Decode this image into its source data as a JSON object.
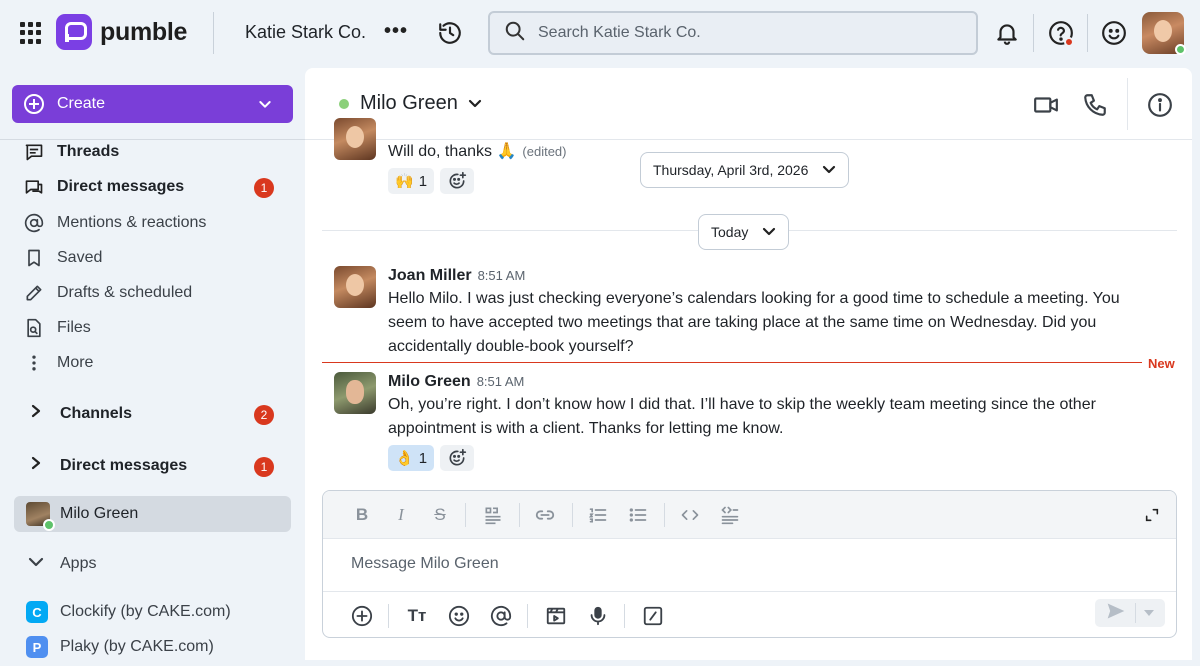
{
  "topbar": {
    "logo_text": "pumble",
    "workspace_name": "Katie Stark Co.",
    "more_label": "•••",
    "search_placeholder": "Search Katie Stark Co."
  },
  "sidebar": {
    "create_label": "Create",
    "nav": [
      {
        "label": "Threads",
        "icon": "threads-icon"
      },
      {
        "label": "Direct messages",
        "icon": "direct-messages-icon",
        "badge": "1"
      },
      {
        "label": "Mentions & reactions",
        "icon": "at-icon"
      },
      {
        "label": "Saved",
        "icon": "bookmark-icon"
      },
      {
        "label": "Drafts & scheduled",
        "icon": "pencil-icon"
      },
      {
        "label": "Files",
        "icon": "file-icon"
      },
      {
        "label": "More",
        "icon": "vertical-dots-icon"
      }
    ],
    "channels": {
      "label": "Channels",
      "badge": "2"
    },
    "direct_messages": {
      "label": "Direct messages",
      "badge": "1"
    },
    "active_dm": "Milo Green",
    "apps_label": "Apps",
    "apps": [
      {
        "label": "Clockify (by CAKE.com)",
        "icon_letter": "C",
        "color": "#03a9f4"
      },
      {
        "label": "Plaky (by CAKE.com)",
        "icon_letter": "P",
        "color": "#4f8ff0"
      }
    ]
  },
  "chat": {
    "title": "Milo Green",
    "date_pill": "Thursday, April 3rd, 2026",
    "today_pill": "Today",
    "new_label": "New",
    "messages": [
      {
        "text": "Will do, thanks 🙏",
        "edited": "(edited)",
        "reactions": [
          {
            "emoji": "🙌",
            "count": "1"
          }
        ]
      },
      {
        "author": "Joan Miller",
        "time": "8:51 AM",
        "text": "Hello Milo. I was just checking everyone’s calendars looking for a good time to schedule a meeting. You seem to have accepted two meetings that are taking place at the same time on Wednesday. Did you accidentally double-book yourself?"
      },
      {
        "author": "Milo Green",
        "time": "8:51 AM",
        "text": "Oh, you’re right. I don’t know how I did that. I’ll have to skip the weekly team meeting since the other appointment is with a client. Thanks for letting me know.",
        "reactions": [
          {
            "emoji": "👌",
            "count": "1"
          }
        ]
      }
    ]
  },
  "composer": {
    "placeholder": "Message Milo Green"
  },
  "colors": {
    "accent": "#7a3ed8",
    "badge": "#d9381e",
    "online": "#5ec26a"
  }
}
